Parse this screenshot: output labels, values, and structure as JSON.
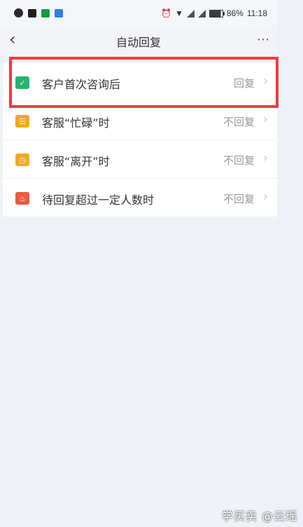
{
  "status_bar": {
    "battery": "86%",
    "time": "11:18"
  },
  "header": {
    "back": "‹",
    "title": "自动回复",
    "more": "⋯"
  },
  "items": [
    {
      "label": "客户首次咨询后",
      "value": "回复",
      "icon": "check-icon",
      "color": "#24b46e"
    },
    {
      "label": "客服“忙碌”时",
      "value": "不回复",
      "icon": "chat-icon",
      "color": "#f2a71f"
    },
    {
      "label": "客服“离开”时",
      "value": "不回复",
      "icon": "clock-icon",
      "color": "#f3a923"
    },
    {
      "label": "待回复超过一定人数时",
      "value": "不回复",
      "icon": "flame-icon",
      "color": "#ea5a3e"
    }
  ],
  "watermark": "学买卖 @云瑶"
}
